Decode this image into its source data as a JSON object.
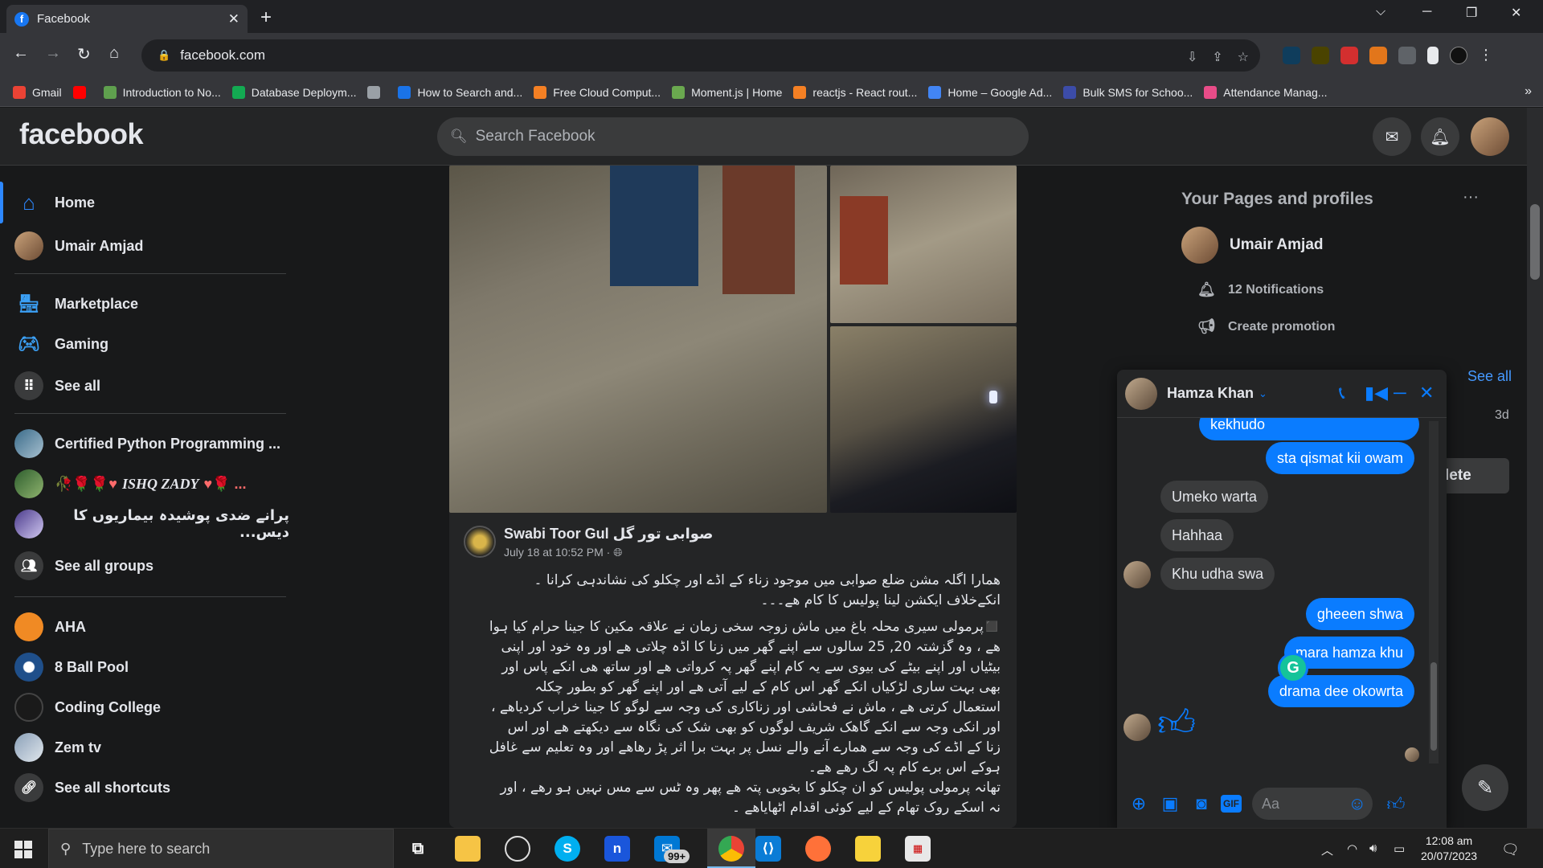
{
  "browser": {
    "tab_title": "Facebook",
    "tab_favicon": "f",
    "url": "facebook.com",
    "bookmarks": [
      {
        "label": "Gmail",
        "color": "#ea4335"
      },
      {
        "label": "",
        "color": "#ff0000"
      },
      {
        "label": "Introduction to No...",
        "color": "#5fa04e"
      },
      {
        "label": "Database Deploym...",
        "color": "#13aa52"
      },
      {
        "label": "",
        "color": "#9aa0a6"
      },
      {
        "label": "How to Search and...",
        "color": "#1a73e8"
      },
      {
        "label": "Free Cloud Comput...",
        "color": "#f48024"
      },
      {
        "label": "Moment.js | Home",
        "color": "#6aa84f"
      },
      {
        "label": "reactjs - React rout...",
        "color": "#f48024"
      },
      {
        "label": "Home – Google Ad...",
        "color": "#4285f4"
      },
      {
        "label": "Bulk SMS for Schoo...",
        "color": "#3c4ca8"
      },
      {
        "label": "Attendance Manag...",
        "color": "#e84c88"
      }
    ],
    "bookmarks_more": "»"
  },
  "facebook": {
    "logo": "facebook",
    "search_placeholder": "Search Facebook"
  },
  "left_nav": {
    "items": [
      {
        "label": "Home",
        "icon": "home-icon"
      },
      {
        "label": "Umair Amjad",
        "icon": "profile-avatar"
      },
      {
        "label": "Marketplace",
        "icon": "shop-icon"
      },
      {
        "label": "Gaming",
        "icon": "gamepad-icon"
      },
      {
        "label": "See all",
        "icon": "grid-icon"
      },
      {
        "label": "Certified Python Programming ...",
        "icon": "group-avatar"
      },
      {
        "label": "ISHQ ZADY",
        "icon": "group-avatar"
      },
      {
        "label": "پرانے ضدی پوشیدہ بیماریوں کا دیس...",
        "icon": "group-avatar"
      },
      {
        "label": "See all groups",
        "icon": "groups-icon"
      },
      {
        "label": "AHA",
        "icon": "aha-avatar"
      },
      {
        "label": "8 Ball Pool",
        "icon": "8ball-avatar"
      },
      {
        "label": "Coding College",
        "icon": "coding-college-avatar"
      },
      {
        "label": "Zem tv",
        "icon": "zemtv-avatar"
      },
      {
        "label": "See all shortcuts",
        "icon": "link-icon"
      }
    ]
  },
  "post": {
    "author": "Swabi Toor Gul صوابی تور گل",
    "time": "July 18 at 10:52 PM ·",
    "text_intro_1": "ھمارا اگلہ مشن ضلع صوابی میں موجود زناء کے اڈے اور چکلو کی نشاندہی کرانا ۔",
    "text_intro_2": "انکےخلاف ایکشن لینا پولیس کا کام ھے۔۔۔",
    "text_body": [
      "◼️پرمولی سیری محلہ باغ میں ماش زوجہ سخی زمان نے علاقہ مکین کا جینا حرام کیا ہوا",
      "ھے ، وہ گزشتہ 20, 25 سالوں سے اپنے گھر میں زنا کا اڈہ چلاتی ھے اور وہ خود اور اپنی",
      "بیٹیاں اور اپنے بیٹے کی بیوی سے یہ کام اپنے گھر پہ کرواتی ھے اور ساتھ ھی انکے پاس اور",
      "بھی بہت ساری لڑکیاں انکے گھر اس کام کے لیے آتی ھے اور اپنے گھر کو بطور چکلہ",
      "استعمال کرتی ھے ، ماش نے فحاشی اور زناکاری کی وجہ سے لوگو کا جینا خراب کردیاھے ،",
      "اور انکی وجہ سے انکے گاھک شریف لوگوں کو بھی شک کی نگاہ سے دیکھتے ھے اور اس",
      "زنا کے اڈے کی وجہ سے ھمارے آنے والے نسل پر بہت برا اثر پڑ رھاھے اور وہ تعلیم سے غافل",
      "ہوکے اس برے کام پہ لگ رھے ھے۔",
      "تھانہ پرمولی پولیس کو ان چکلو کا بخوبی پتہ ھے پھر وہ ٹس سے مس نہیں ہو رھے ، اور",
      "نہ اسکے روک تھام کے لیے کوئی اقدام اٹھایاھے ۔"
    ]
  },
  "right_panel": {
    "title": "Your Pages and profiles",
    "profile_name": "Umair Amjad",
    "notifications": "12 Notifications",
    "create_promotion": "Create promotion",
    "see_all": "See all",
    "time_ago": "3d",
    "delete_partial": "lete"
  },
  "chat": {
    "name": "Hamza Khan",
    "messages": [
      {
        "text": "kekhudo",
        "dir": "out"
      },
      {
        "text": "sta qismat kii owam",
        "dir": "out"
      },
      {
        "text": "Umeko warta",
        "dir": "in"
      },
      {
        "text": "Hahhaa",
        "dir": "in"
      },
      {
        "text": "Khu udha swa",
        "dir": "in"
      },
      {
        "text": "gheeen shwa",
        "dir": "out"
      },
      {
        "text": "mara hamza khu",
        "dir": "out"
      },
      {
        "text": "drama dee okowrta",
        "dir": "out"
      }
    ],
    "composer_placeholder": "Aa"
  },
  "taskbar": {
    "search_placeholder": "Type here to search",
    "mail_badge": "99+",
    "time": "12:08 am",
    "date": "20/07/2023"
  }
}
